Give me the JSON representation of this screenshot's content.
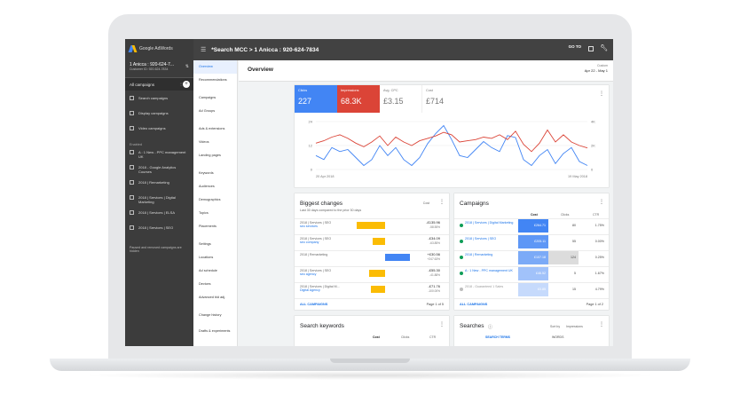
{
  "app": {
    "logo_text": "Google AdWords"
  },
  "account": {
    "name": "1 Anicca : 920-624-7...",
    "customer_id": "Customer ID: 920-624-7834"
  },
  "topbar": {
    "title": "*Search MCC  >  1 Anicca : 920-624-7834",
    "goto_label": "GO TO"
  },
  "sidebar": {
    "all_campaigns": "All campaigns",
    "items": [
      {
        "label": "Search campaigns"
      },
      {
        "label": "Display campaigns"
      },
      {
        "label": "Video campaigns"
      }
    ],
    "enabled_heading": "Enabled",
    "enabled_items": [
      {
        "label": "A : 1 New - PPC management UK"
      },
      {
        "label": "2018 - Google Analytics Courses"
      },
      {
        "label": "2018 | Remarketing"
      },
      {
        "label": "2018 | Services | Digital Marketing"
      },
      {
        "label": "2018 | Services | ELSA"
      },
      {
        "label": "2018 | Services | SEO"
      }
    ],
    "footer_note": "Paused and removed campaigns are hidden"
  },
  "nav": [
    "Overview",
    "Recommendations",
    "Campaigns",
    "Ad Groups",
    "Ads & extensions",
    "Videos",
    "Landing pages",
    "Keywords",
    "Audiences",
    "Demographics",
    "Topics",
    "Placements",
    "Settings",
    "Locations",
    "Ad schedule",
    "Devices",
    "Advanced bid adj.",
    "Change history",
    "Drafts & experiments"
  ],
  "overview": {
    "title": "Overview",
    "custom_label": "Custom",
    "date_range": "Apr 22 - May 1"
  },
  "chart_data": {
    "type": "line",
    "tiles": [
      {
        "label": "Clicks",
        "value": "227",
        "color": "#4285f4"
      },
      {
        "label": "Impressions",
        "value": "68.3K",
        "color": "#db4437"
      },
      {
        "label": "Avg. CPC",
        "value": "£3.15"
      },
      {
        "label": "Cost",
        "value": "£714"
      }
    ],
    "x_start_label": "20 Apr 2018",
    "x_end_label": "19 May 2018",
    "left_ticks": [
      "24",
      "12",
      "0"
    ],
    "right_ticks": [
      "4K",
      "2K",
      "0"
    ],
    "left_ylim": [
      0,
      24
    ],
    "right_ylim": [
      0,
      4000
    ],
    "series": [
      {
        "name": "Clicks",
        "color": "#4285f4",
        "axis": "left",
        "values": [
          7,
          5,
          11,
          9,
          10,
          6,
          2,
          5,
          12,
          7,
          11,
          5,
          2,
          6,
          13,
          18,
          22,
          15,
          7,
          6,
          10,
          14,
          11,
          9,
          17,
          16,
          5,
          2,
          7,
          10,
          3,
          8,
          11,
          4,
          2
        ]
      },
      {
        "name": "Impressions",
        "color": "#db4437",
        "axis": "right",
        "values": [
          2200,
          2400,
          2700,
          2900,
          2600,
          2200,
          1900,
          2300,
          2800,
          2000,
          2700,
          2300,
          2000,
          2400,
          2600,
          2800,
          3100,
          2900,
          2300,
          2400,
          2500,
          2700,
          2600,
          2900,
          2500,
          3200,
          2100,
          1500,
          2200,
          3300,
          2300,
          2900,
          2300,
          2000,
          1800
        ]
      }
    ]
  },
  "biggest_changes": {
    "title": "Biggest changes",
    "subtitle": "Last 30 days compared to the prior 30 days",
    "sort_label": "Cost",
    "rows": [
      {
        "name": "2018 | Services | SEO",
        "sub": "seo services",
        "value": "-£135.96",
        "pct": "-58.55%",
        "color": "#fbbc04",
        "bar_left": 70,
        "bar_width": 32
      },
      {
        "name": "2018 | Services | SEO",
        "sub": "seo company",
        "value": "-£34.09",
        "pct": "-63.85%",
        "color": "#fbbc04",
        "bar_left": 88,
        "bar_width": 14
      },
      {
        "name": "2018 | Remarketing",
        "sub": "",
        "value": "+£30.56",
        "pct": "+247.63%",
        "color": "#4285f4",
        "bar_left": 102,
        "bar_width": 28
      },
      {
        "name": "2018 | Services | SEO",
        "sub": "seo agency",
        "value": "-£55.30",
        "pct": "-41.88%",
        "color": "#fbbc04",
        "bar_left": 84,
        "bar_width": 18
      },
      {
        "name": "2018 | Services | Digital M...",
        "sub": "Digital Agency",
        "value": "-£71.76",
        "pct": "-100.00%",
        "color": "#fbbc04",
        "bar_left": 86,
        "bar_width": 16
      }
    ],
    "footer_link": "ALL CAMPAIGNS",
    "pager": "Page 1 of 5"
  },
  "campaigns": {
    "title": "Campaigns",
    "col_cost": "Cost",
    "col_clicks": "Clicks",
    "col_ctr": "CTR",
    "rows": [
      {
        "name": "2018 | Services | Digital Marketing",
        "cost": "£264.71",
        "clicks": "80",
        "ctr": "1.75%",
        "status_color": "#0f9d58",
        "cost_bg": "#4285f4",
        "clk_bg": "#ffffff"
      },
      {
        "name": "2018 | Services | SEO",
        "cost": "£205.11",
        "clicks": "55",
        "ctr": "0.00%",
        "status_color": "#0f9d58",
        "cost_bg": "#5e97f6",
        "clk_bg": "#ffffff"
      },
      {
        "name": "2018 | Remarketing",
        "cost": "£107.18",
        "clicks": "124",
        "ctr": "0.25%",
        "status_color": "#0f9d58",
        "cost_bg": "#7baaf7",
        "clk_bg": "#dcdcdc"
      },
      {
        "name": "A : 1 New - PPC management UK",
        "cost": "£46.52",
        "clicks": "5",
        "ctr": "1.67%",
        "status_color": "#0f9d58",
        "cost_bg": "#a1c2fa",
        "clk_bg": "#ffffff"
      },
      {
        "name": "2018 - Guaranteed 1 Sales",
        "cost": "£0.85",
        "clicks": "15",
        "ctr": "4.79%",
        "status_color": "#bdbdbd",
        "cost_bg": "#c6dafc",
        "clk_bg": "#ffffff"
      }
    ],
    "footer_link": "ALL CAMPAIGNS",
    "pager": "Page 1 of 2"
  },
  "search_keywords": {
    "title": "Search keywords",
    "col_cost": "Cost",
    "col_clicks": "Clicks",
    "col_ctr": "CTR"
  },
  "searches": {
    "title": "Searches",
    "sort_label": "Sort by",
    "sort_value": "Impressions",
    "tab_terms": "SEARCH TERMS",
    "tab_words": "WORDS"
  }
}
